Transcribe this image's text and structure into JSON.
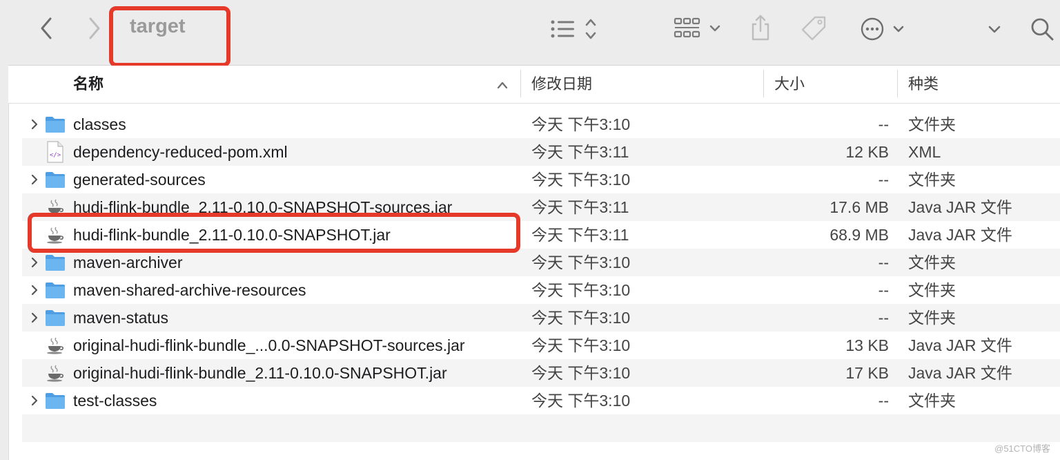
{
  "window": {
    "title": "target"
  },
  "header": {
    "name": "名称",
    "date": "修改日期",
    "size": "大小",
    "kind": "种类"
  },
  "toolbar_icons": [
    "back-icon",
    "forward-icon",
    "list-view-icon",
    "group-view-icon",
    "share-icon",
    "tag-icon",
    "more-icon",
    "search-icon"
  ],
  "accent": {
    "highlight": "#e53a2a",
    "folder": "#5aa9e6"
  },
  "files": [
    {
      "name": "classes",
      "date": "今天 下午3:10",
      "size": "--",
      "kind": "文件夹",
      "type": "folder"
    },
    {
      "name": "dependency-reduced-pom.xml",
      "date": "今天 下午3:11",
      "size": "12 KB",
      "kind": "XML",
      "type": "xml"
    },
    {
      "name": "generated-sources",
      "date": "今天 下午3:10",
      "size": "--",
      "kind": "文件夹",
      "type": "folder"
    },
    {
      "name": "hudi-flink-bundle_2.11-0.10.0-SNAPSHOT-sources.jar",
      "date": "今天 下午3:11",
      "size": "17.6 MB",
      "kind": "Java JAR 文件",
      "type": "jar"
    },
    {
      "name": "hudi-flink-bundle_2.11-0.10.0-SNAPSHOT.jar",
      "date": "今天 下午3:11",
      "size": "68.9 MB",
      "kind": "Java JAR 文件",
      "type": "jar"
    },
    {
      "name": "maven-archiver",
      "date": "今天 下午3:10",
      "size": "--",
      "kind": "文件夹",
      "type": "folder"
    },
    {
      "name": "maven-shared-archive-resources",
      "date": "今天 下午3:10",
      "size": "--",
      "kind": "文件夹",
      "type": "folder"
    },
    {
      "name": "maven-status",
      "date": "今天 下午3:10",
      "size": "--",
      "kind": "文件夹",
      "type": "folder"
    },
    {
      "name": "original-hudi-flink-bundle_...0.0-SNAPSHOT-sources.jar",
      "date": "今天 下午3:10",
      "size": "13 KB",
      "kind": "Java JAR 文件",
      "type": "jar"
    },
    {
      "name": "original-hudi-flink-bundle_2.11-0.10.0-SNAPSHOT.jar",
      "date": "今天 下午3:10",
      "size": "17 KB",
      "kind": "Java JAR 文件",
      "type": "jar"
    },
    {
      "name": "test-classes",
      "date": "今天 下午3:10",
      "size": "--",
      "kind": "文件夹",
      "type": "folder"
    }
  ],
  "watermark": "@51CTO博客"
}
